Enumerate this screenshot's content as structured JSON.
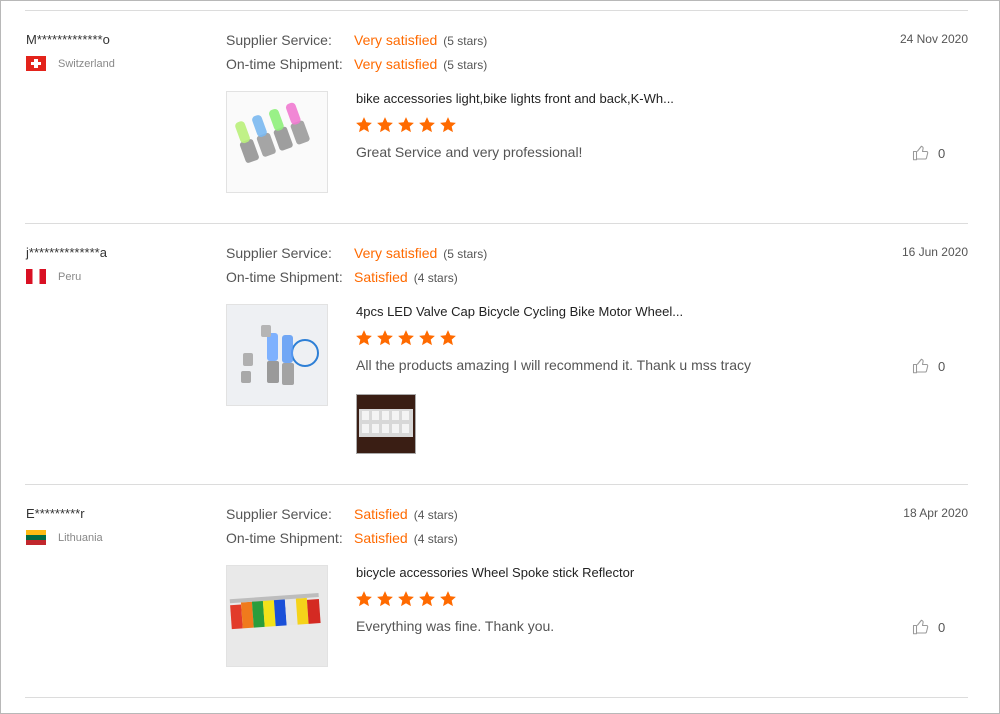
{
  "labels": {
    "supplier_service": "Supplier Service:",
    "ontime_shipment": "On-time Shipment:"
  },
  "colors": {
    "accent": "#ff6a00",
    "star": "#ff6a00",
    "divider": "#dcdcdc"
  },
  "reviews": [
    {
      "user": "M*************o",
      "country": "Switzerland",
      "flag_icon": "switzerland-flag-icon",
      "supplier_service": {
        "value": "Very satisfied",
        "count": "(5 stars)"
      },
      "ontime_shipment": {
        "value": "Very satisfied",
        "count": "(5 stars)"
      },
      "date": "24 Nov 2020",
      "product_title": "bike accessories light,bike lights front and back,K-Wh...",
      "rating": 5,
      "comment": "Great Service and very professional!",
      "helpful_count": "0"
    },
    {
      "user": "j**************a",
      "country": "Peru",
      "flag_icon": "peru-flag-icon",
      "supplier_service": {
        "value": "Very satisfied",
        "count": "(5 stars)"
      },
      "ontime_shipment": {
        "value": "Satisfied",
        "count": "(4 stars)"
      },
      "date": "16 Jun 2020",
      "product_title": "4pcs LED Valve Cap Bicycle Cycling Bike Motor Wheel...",
      "rating": 5,
      "comment": "All the products amazing I will recommend it. Thank u mss tracy",
      "helpful_count": "0"
    },
    {
      "user": "E*********r",
      "country": "Lithuania",
      "flag_icon": "lithuania-flag-icon",
      "supplier_service": {
        "value": "Satisfied",
        "count": "(4 stars)"
      },
      "ontime_shipment": {
        "value": "Satisfied",
        "count": "(4 stars)"
      },
      "date": "18 Apr 2020",
      "product_title": "bicycle accessories Wheel Spoke stick Reflector",
      "rating": 5,
      "comment": "Everything was fine. Thank you.",
      "helpful_count": "0"
    }
  ]
}
